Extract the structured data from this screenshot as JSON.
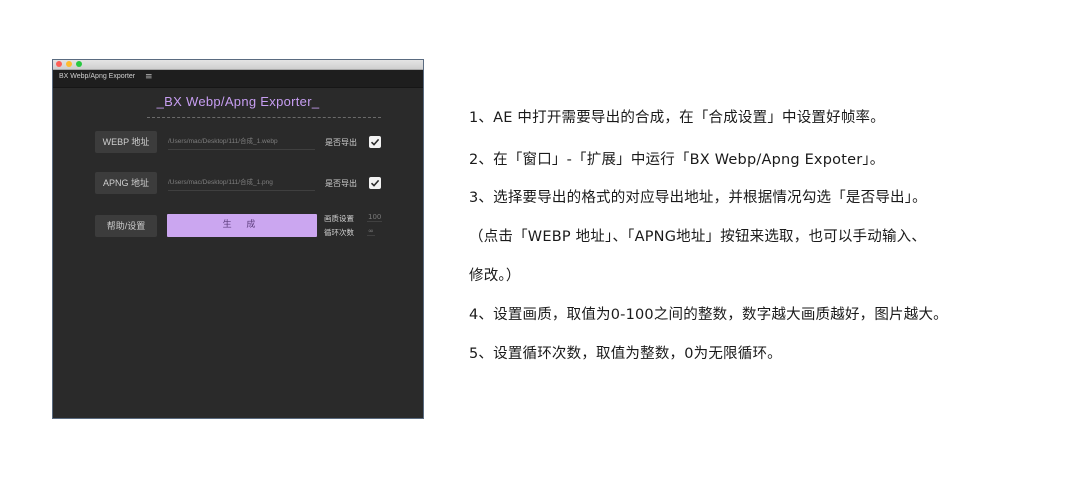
{
  "window": {
    "panel_tab": "BX Webp/Apng Exporter",
    "panel_menu_icon": "hamburger-menu-icon",
    "panel_title": "_BX Webp/Apng Exporter_"
  },
  "webp": {
    "button": "WEBP 地址",
    "path": "/Users/mac/Desktop/111/合成_1.webp",
    "export_label": "是否导出",
    "export_checked": true
  },
  "apng": {
    "button": "APNG 地址",
    "path": "/Users/mac/Desktop/111/合成_1.png",
    "export_label": "是否导出",
    "export_checked": true
  },
  "actions": {
    "help_button": "帮助/设置",
    "generate_button": "生 成",
    "quality_label": "画质设置",
    "quality_value": "100",
    "loop_label": "循环次数",
    "loop_value": "∞"
  },
  "instructions": [
    "1、AE 中打开需要导出的合成，在「合成设置」中设置好帧率。",
    "2、在「窗口」-「扩展」中运行「BX Webp/Apng Expoter」。",
    "3、选择要导出的格式的对应导出地址，并根据情况勾选「是否导出」。",
    "（点击「WEBP 地址」、「APNG地址」按钮来选取，也可以手动输入、",
    "修改。）",
    "4、设置画质，取值为0-100之间的整数，数字越大画质越好，图片越大。",
    "5、设置循环次数，取值为整数，0为无限循环。"
  ],
  "colors": {
    "accent": "#cba6f0",
    "title": "#c79ef2",
    "panel_bg": "#2a2a2a"
  }
}
